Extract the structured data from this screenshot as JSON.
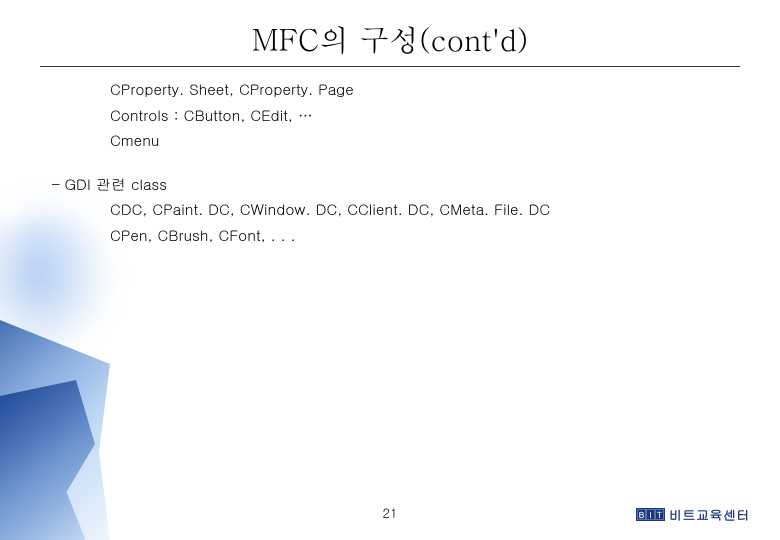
{
  "title": "MFC의 구성(cont'd)",
  "lines": {
    "l1": "CProperty. Sheet, CProperty. Page",
    "l2": "Controls : CButton, CEdit, …",
    "l3": "Cmenu",
    "section": "– GDI 관련 class",
    "l4": "CDC, CPaint. DC, CWindow. DC, CClient. DC, CMeta. File. DC",
    "l5": "CPen, CBrush, CFont, . . ."
  },
  "page_number": "21",
  "footer": {
    "logo_letters": [
      "B",
      "I",
      "T"
    ],
    "logo_text": "비트교육센터"
  }
}
